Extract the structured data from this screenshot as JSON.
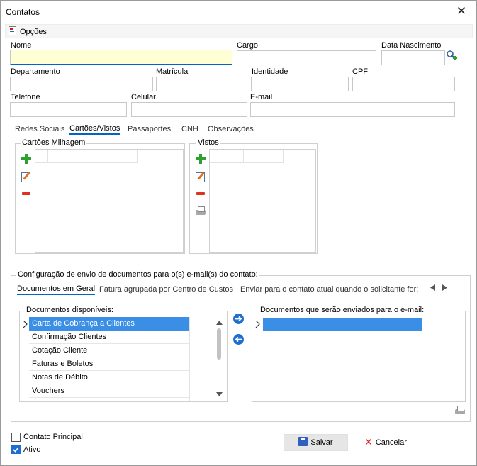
{
  "window": {
    "title": "Contatos",
    "close_label": "✕"
  },
  "toolbar": {
    "opcoes_label": "Opções"
  },
  "fields": {
    "nome": {
      "label": "Nome",
      "value": ""
    },
    "cargo": {
      "label": "Cargo",
      "value": ""
    },
    "data_nascimento": {
      "label": "Data Nascimento",
      "value": ""
    },
    "departamento": {
      "label": "Departamento",
      "value": ""
    },
    "matricula": {
      "label": "Matrícula",
      "value": ""
    },
    "identidade": {
      "label": "Identidade",
      "value": ""
    },
    "cpf": {
      "label": "CPF",
      "value": ""
    },
    "telefone": {
      "label": "Telefone",
      "value": ""
    },
    "celular": {
      "label": "Celular",
      "value": ""
    },
    "email": {
      "label": "E-mail",
      "value": ""
    }
  },
  "tabs": [
    "Redes Sociais",
    "Cartões/Vistos",
    "Passaportes",
    "CNH",
    "Observações"
  ],
  "groups": {
    "cartoes": {
      "title": "Cartões Milhagem"
    },
    "vistos": {
      "title": "Vistos"
    }
  },
  "config": {
    "title": "Configuração de envio de documentos para o(s) e-mail(s) do contato:",
    "subtabs": [
      "Documentos em Geral",
      "Fatura agrupada por Centro de Custos",
      "Enviar para o contato atual quando o solicitante for:"
    ],
    "available": {
      "title": "Documentos disponíveis:",
      "items": [
        "Carta de Cobrança a Clientes",
        "Confirmação Clientes",
        "Cotação Cliente",
        "Faturas e Boletos",
        "Notas de Débito",
        "Vouchers"
      ]
    },
    "selected": {
      "title": "Documentos que serão enviados para o e-mail:"
    }
  },
  "checks": {
    "contato_principal": {
      "label": "Contato Principal",
      "checked": false
    },
    "ativo": {
      "label": "Ativo",
      "checked": true
    }
  },
  "buttons": {
    "salvar": "Salvar",
    "cancelar": "Cancelar"
  }
}
